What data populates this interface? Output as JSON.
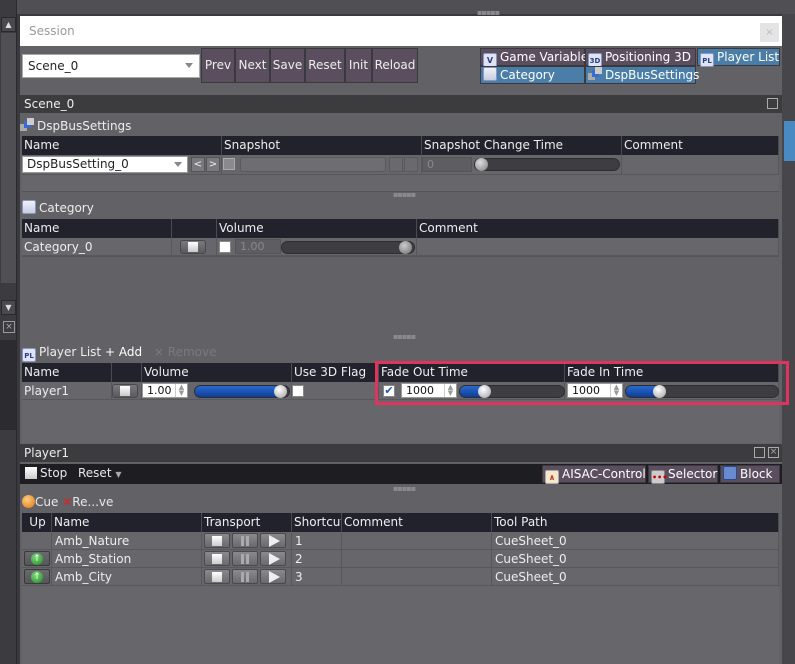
{
  "window": {
    "title": "Session",
    "close_label": "×"
  },
  "toolbar": {
    "scene_select": "Scene_0",
    "buttons": [
      "Prev",
      "Next",
      "Save",
      "Reset",
      "Init",
      "Reload"
    ]
  },
  "tabs": [
    {
      "label": "Game Variable",
      "icon": "V",
      "active": false
    },
    {
      "label": "Positioning 3D",
      "icon": "3D",
      "active": false
    },
    {
      "label": "Player List",
      "icon": "PL",
      "active": true
    },
    {
      "label": "Category",
      "icon": "category-icon",
      "active": true
    },
    {
      "label": "DspBusSettings",
      "icon": "dsp-bus-icon",
      "active": true
    }
  ],
  "scene_panel": {
    "title": "Scene_0"
  },
  "dsp": {
    "label": "DspBusSettings",
    "columns": [
      "Name",
      "Snapshot",
      "Snapshot Change Time",
      "Comment"
    ],
    "row": {
      "name": "DspBusSetting_0",
      "prev": "<",
      "next": ">",
      "change_time": "0",
      "comment": ""
    }
  },
  "category": {
    "label": "Category",
    "columns": [
      "Name",
      "",
      "Volume",
      "Comment"
    ],
    "row": {
      "name": "Category_0",
      "volume": "1.00",
      "volume_fraction": 1.0,
      "comment": ""
    }
  },
  "player_list": {
    "label": "Player List",
    "add_label": "+ Add",
    "remove_label": "× Remove",
    "columns": [
      "Name",
      "",
      "Volume",
      "Use 3D Flag",
      "Fade Out Time",
      "Fade In Time"
    ],
    "row": {
      "name": "Player1",
      "volume": "1.00",
      "volume_fraction": 1.0,
      "use_3d": false,
      "fade_out_enabled": true,
      "fade_out_time": "1000",
      "fade_out_fraction": 0.2,
      "fade_in_time": "1000",
      "fade_in_fraction": 0.2
    }
  },
  "player_panel": {
    "title": "Player1",
    "stop_label": "Stop",
    "reset_label": "Reset",
    "tools": [
      "AISAC-Control",
      "Selector",
      "Block"
    ],
    "cue_label": "Cue",
    "remove_label": "Re...ve",
    "columns": [
      "Up",
      "Name",
      "Transport",
      "Shortcut",
      "Comment",
      "Tool Path"
    ],
    "rows": [
      {
        "up": false,
        "name": "Amb_Nature",
        "shortcut": "1",
        "comment": "",
        "tool_path": "CueSheet_0"
      },
      {
        "up": true,
        "name": "Amb_Station",
        "shortcut": "2",
        "comment": "",
        "tool_path": "CueSheet_0"
      },
      {
        "up": true,
        "name": "Amb_City",
        "shortcut": "3",
        "comment": "",
        "tool_path": "CueSheet_0"
      }
    ]
  },
  "colors": {
    "highlight": "#e0345e",
    "tab_active": "#4a7ea8",
    "button": "#5b4f5f",
    "slider_fill": "#1e56b8"
  }
}
